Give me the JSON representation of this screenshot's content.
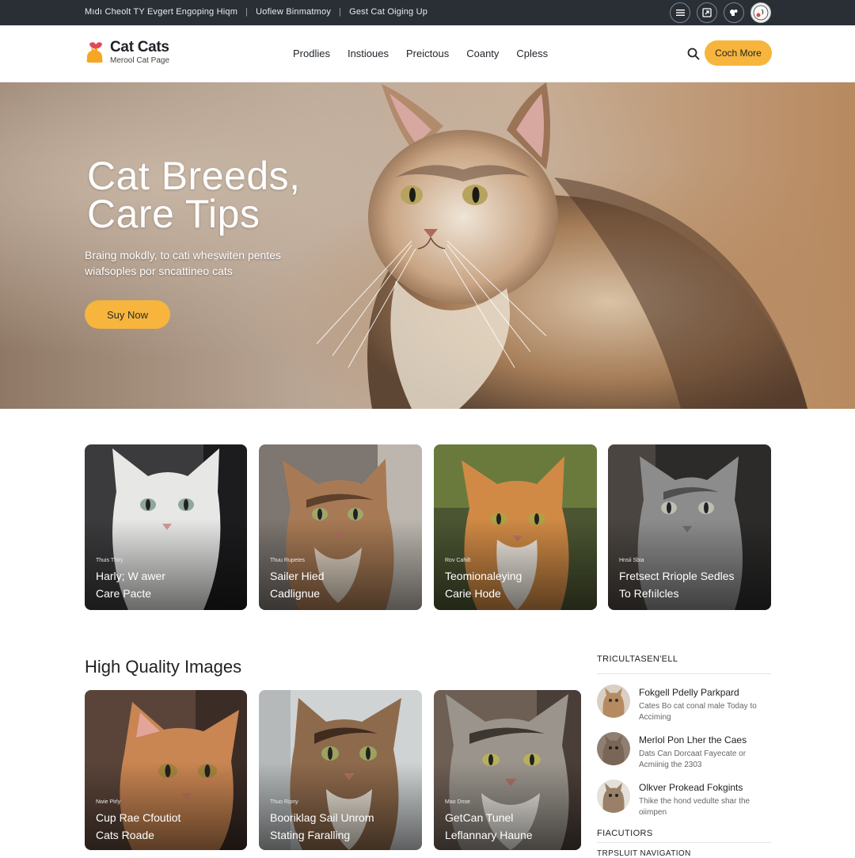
{
  "topbar": {
    "links": [
      "Mıdı Cheolt TY Evgert Engoping Hiqm",
      "Uofiew Binmatmoy",
      "Gest Cat Oiging Up"
    ],
    "icons": [
      "menu-icon",
      "export-icon",
      "puzzle-icon",
      "avatar"
    ]
  },
  "header": {
    "brand": "Cat Cats",
    "tagline": "Merool Cat Page",
    "nav": [
      "Prodlies",
      "Instioues",
      "Preictous",
      "Coanty",
      "Cpless"
    ],
    "cta": "Coch More",
    "accent": "#f7b53d"
  },
  "hero": {
    "title": "Cat Breeds,\nCare Tips",
    "subtitle": "Braing mokdly, to cati whes̤witen pentes wiafsoples por sncattineo cats",
    "button": "Suy Now"
  },
  "cards_row1": [
    {
      "kicker": "Thuis Thiry",
      "title": "Harly; W awer\nCare Pacte"
    },
    {
      "kicker": "Thuu Rupetes",
      "title": "Sailer Hied\nCadlignue"
    },
    {
      "kicker": "Rov Cahilt",
      "title": "Teomionaleying\nCarie Hode"
    },
    {
      "kicker": "Hnsii Sbia",
      "title": "Fretsect Rriople Sedles\nTo Refıilcles"
    }
  ],
  "section_title": "High Quality Images",
  "cards_row2": [
    {
      "kicker": "Nwie Pirly",
      "title": "Cup Rae Cfoutiot\nCats Roade"
    },
    {
      "kicker": "Thuo Ripny",
      "title": "Booriklag Sail Unrom\nStating Faralling"
    },
    {
      "kicker": "Mao Dnse",
      "title": "GetCan Tunel\nLeflannary Haune"
    }
  ],
  "sidebar": {
    "heading": "TRICULTASEN'ELL",
    "items": [
      {
        "title": "Fokgell Pdelly Parkpard",
        "desc": "Cates Bo cat conal male Today to Acciming"
      },
      {
        "title": "Merlol Pon Lher the Caes",
        "desc": "Dats Can Dorcaat Fayecate or Acmiinig the 2303"
      },
      {
        "title": "Olkver Prokead Fokgints",
        "desc": "Thike the hond vedulte shar the oiimpen"
      }
    ],
    "heading2": "FIACUTIORS",
    "heading3": "TRPSLUIT NAVIGATION"
  }
}
